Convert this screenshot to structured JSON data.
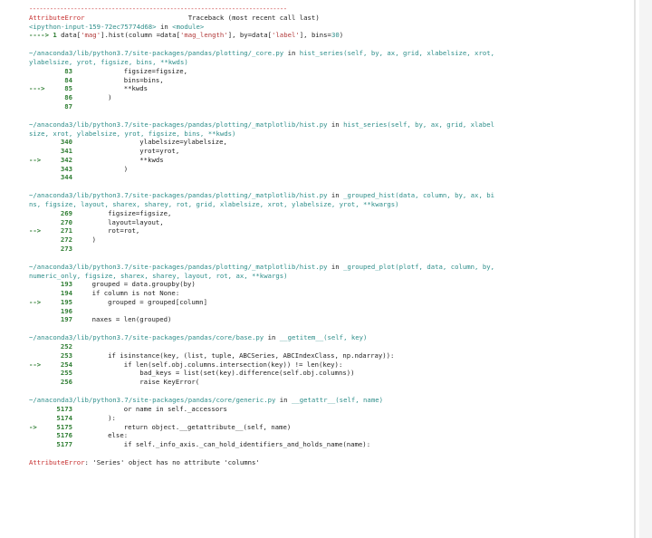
{
  "traceback": {
    "separator": "---------------------------------------------------------------------------",
    "error_type": "AttributeError",
    "header": "Traceback (most recent call last)",
    "input_ref": "<ipython-input-159-72ec75774d68>",
    "input_in": " in ",
    "input_module": "<module>",
    "input_arrow": "----> 1 ",
    "input_code_a": "data[",
    "input_str_1": "'mag'",
    "input_code_b": "].hist(column =data[",
    "input_str_2": "'mag_length'",
    "input_code_c": "], by=data[",
    "input_str_3": "'label'",
    "input_code_d": "], bins=",
    "input_num": "30",
    "input_code_e": ")",
    "frames": [
      {
        "path": "~/anaconda3/lib/python3.7/site-packages/pandas/plotting/_core.py",
        "in": " in ",
        "func": "hist_series",
        "sig_line1": "(self, by, ax, grid, xlabelsize, xrot,",
        "sig_line2": "ylabelsize, yrot, figsize, bins, **kwds)",
        "lines": [
          {
            "marker": "",
            "num": "83",
            "code": "            figsize=figsize,"
          },
          {
            "marker": "",
            "num": "84",
            "code": "            bins=bins,"
          },
          {
            "marker": "---> ",
            "num": "85",
            "code": "            **kwds"
          },
          {
            "marker": "",
            "num": "86",
            "code": "        )"
          },
          {
            "marker": "",
            "num": "87",
            "code": ""
          }
        ]
      },
      {
        "path": "~/anaconda3/lib/python3.7/site-packages/pandas/plotting/_matplotlib/hist.py",
        "in": " in ",
        "func": "hist_series",
        "sig_line1": "(self, by, ax, grid, xlabel",
        "sig_line2": "size, xrot, ylabelsize, yrot, figsize, bins, **kwds)",
        "lines": [
          {
            "marker": "",
            "num": "340",
            "code": "                ylabelsize=ylabelsize,"
          },
          {
            "marker": "",
            "num": "341",
            "code": "                yrot=yrot,"
          },
          {
            "marker": "--> ",
            "num": "342",
            "code": "                **kwds"
          },
          {
            "marker": "",
            "num": "343",
            "code": "            )"
          },
          {
            "marker": "",
            "num": "344",
            "code": ""
          }
        ]
      },
      {
        "path": "~/anaconda3/lib/python3.7/site-packages/pandas/plotting/_matplotlib/hist.py",
        "in": " in ",
        "func": "_grouped_hist",
        "sig_line1": "(data, column, by, ax, bi",
        "sig_line2": "ns, figsize, layout, sharex, sharey, rot, grid, xlabelsize, xrot, ylabelsize, yrot, **kwargs)",
        "lines": [
          {
            "marker": "",
            "num": "269",
            "code": "        figsize=figsize,"
          },
          {
            "marker": "",
            "num": "270",
            "code": "        layout=layout,"
          },
          {
            "marker": "--> ",
            "num": "271",
            "code": "        rot=rot,"
          },
          {
            "marker": "",
            "num": "272",
            "code": "    )"
          },
          {
            "marker": "",
            "num": "273",
            "code": ""
          }
        ]
      },
      {
        "path": "~/anaconda3/lib/python3.7/site-packages/pandas/plotting/_matplotlib/hist.py",
        "in": " in ",
        "func": "_grouped_plot",
        "sig_line1": "(plotf, data, column, by,",
        "sig_line2": "numeric_only, figsize, sharex, sharey, layout, rot, ax, **kwargs)",
        "lines": [
          {
            "marker": "",
            "num": "193",
            "code": "    grouped = data.groupby(by)"
          },
          {
            "marker": "",
            "num": "194",
            "code": "    if column is not None:"
          },
          {
            "marker": "--> ",
            "num": "195",
            "code": "        grouped = grouped[column]"
          },
          {
            "marker": "",
            "num": "196",
            "code": ""
          },
          {
            "marker": "",
            "num": "197",
            "code": "    naxes = len(grouped)"
          }
        ]
      },
      {
        "path": "~/anaconda3/lib/python3.7/site-packages/pandas/core/base.py",
        "in": " in ",
        "func": "__getitem__",
        "sig_line1": "(self, key)",
        "sig_line2": "",
        "lines": [
          {
            "marker": "",
            "num": "252",
            "code": ""
          },
          {
            "marker": "",
            "num": "253",
            "code": "        if isinstance(key, (list, tuple, ABCSeries, ABCIndexClass, np.ndarray)):"
          },
          {
            "marker": "--> ",
            "num": "254",
            "code": "            if len(self.obj.columns.intersection(key)) != len(key):"
          },
          {
            "marker": "",
            "num": "255",
            "code": "                bad_keys = list(set(key).difference(self.obj.columns))"
          },
          {
            "marker": "",
            "num": "256",
            "code": "                raise KeyError("
          }
        ]
      },
      {
        "path": "~/anaconda3/lib/python3.7/site-packages/pandas/core/generic.py",
        "in": " in ",
        "func": "__getattr__",
        "sig_line1": "(self, name)",
        "sig_line2": "",
        "lines": [
          {
            "marker": "",
            "num": "5173",
            "code": "            or name in self._accessors"
          },
          {
            "marker": "",
            "num": "5174",
            "code": "        ):"
          },
          {
            "marker": "-> ",
            "num": "5175",
            "code": "            return object.__getattribute__(self, name)"
          },
          {
            "marker": "",
            "num": "5176",
            "code": "        else:"
          },
          {
            "marker": "",
            "num": "5177",
            "code": "            if self._info_axis._can_hold_identifiers_and_holds_name(name):"
          }
        ]
      }
    ],
    "final_error_type": "AttributeError",
    "final_message": ": 'Series' object has no attribute 'columns'"
  }
}
